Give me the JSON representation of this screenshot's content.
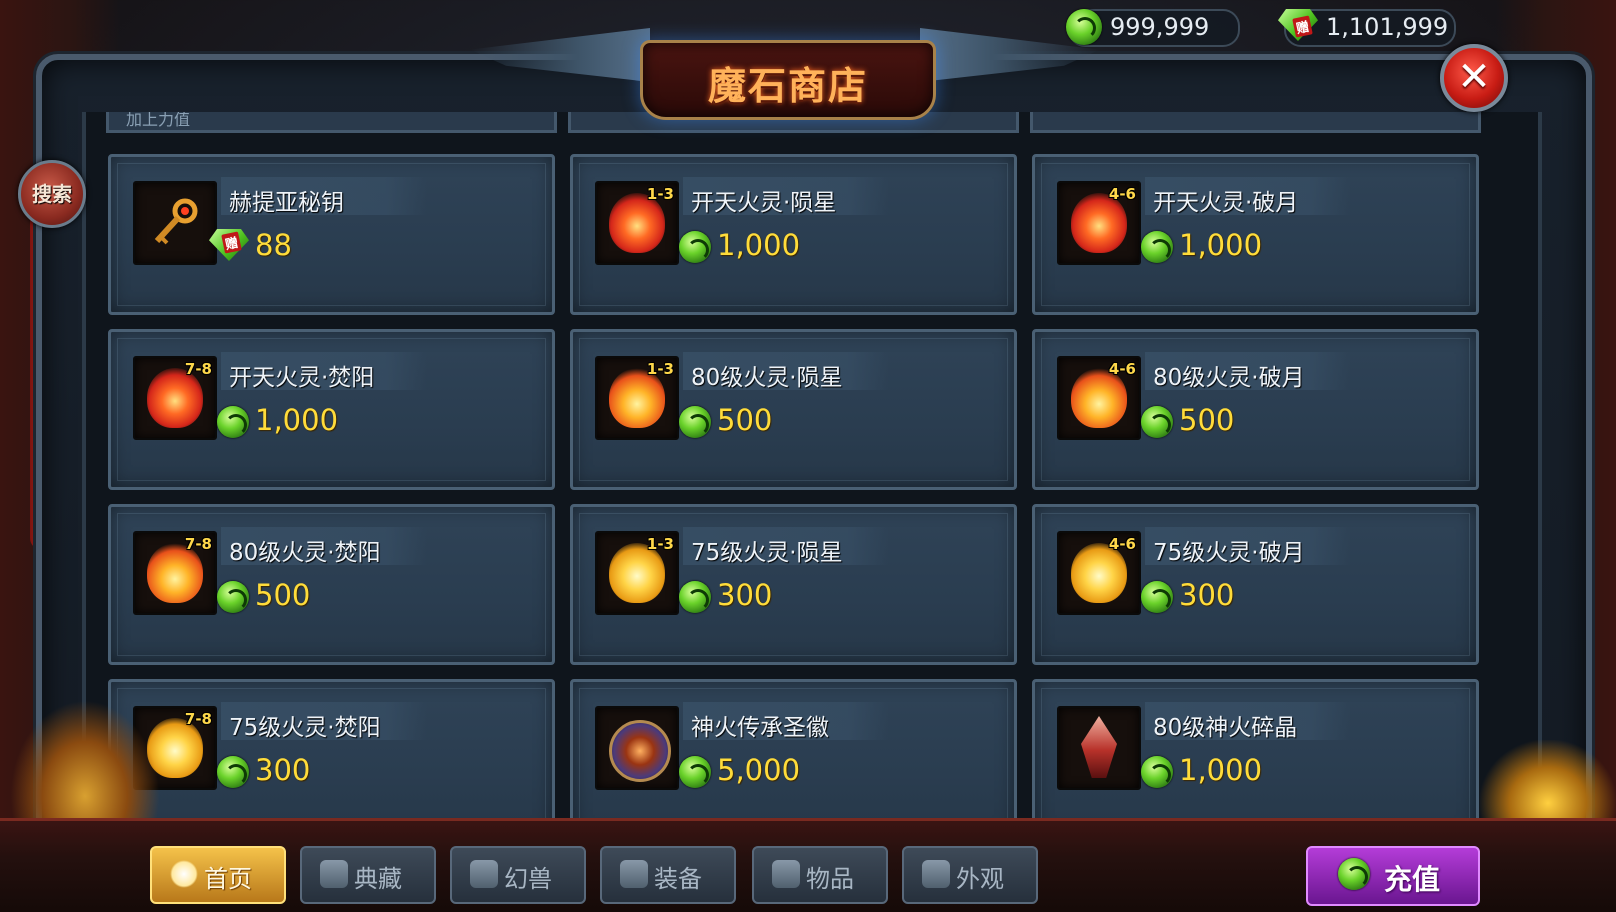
{
  "header": {
    "title": "魔石商店",
    "currency_main": "999,999",
    "currency_gift": "1,101,999",
    "gift_tag": "赠",
    "close_label": "✕"
  },
  "search_label": "搜索",
  "partial_row_label": "加上力值",
  "items": [
    {
      "name": "赫提亚秘钥",
      "price": "88",
      "badge": "",
      "gift": true,
      "icon": "key-icon"
    },
    {
      "name": "开天火灵·陨星",
      "price": "1,000",
      "badge": "1-3",
      "gift": false,
      "icon": "red-flame-icon"
    },
    {
      "name": "开天火灵·破月",
      "price": "1,000",
      "badge": "4-6",
      "gift": false,
      "icon": "red-flame-icon"
    },
    {
      "name": "开天火灵·焚阳",
      "price": "1,000",
      "badge": "7-8",
      "gift": false,
      "icon": "red-flame-icon"
    },
    {
      "name": "80级火灵·陨星",
      "price": "500",
      "badge": "1-3",
      "gift": false,
      "icon": "flame-icon"
    },
    {
      "name": "80级火灵·破月",
      "price": "500",
      "badge": "4-6",
      "gift": false,
      "icon": "flame-icon"
    },
    {
      "name": "80级火灵·焚阳",
      "price": "500",
      "badge": "7-8",
      "gift": false,
      "icon": "flame-icon"
    },
    {
      "name": "75级火灵·陨星",
      "price": "300",
      "badge": "1-3",
      "gift": false,
      "icon": "gold-flame-icon"
    },
    {
      "name": "75级火灵·破月",
      "price": "300",
      "badge": "4-6",
      "gift": false,
      "icon": "gold-flame-icon"
    },
    {
      "name": "75级火灵·焚阳",
      "price": "300",
      "badge": "7-8",
      "gift": false,
      "icon": "gold-flame-icon"
    },
    {
      "name": "神火传承圣徽",
      "price": "5,000",
      "badge": "",
      "gift": false,
      "icon": "emblem-icon"
    },
    {
      "name": "80级神火碎晶",
      "price": "1,000",
      "badge": "",
      "gift": false,
      "icon": "crystal-icon"
    }
  ],
  "tabs": [
    {
      "label": "首页",
      "active": true,
      "icon": "home-icon"
    },
    {
      "label": "典藏",
      "active": false,
      "icon": "scroll-icon"
    },
    {
      "label": "幻兽",
      "active": false,
      "icon": "beast-icon"
    },
    {
      "label": "装备",
      "active": false,
      "icon": "axe-icon"
    },
    {
      "label": "物品",
      "active": false,
      "icon": "flower-icon"
    },
    {
      "label": "外观",
      "active": false,
      "icon": "armor-icon"
    }
  ],
  "recharge_label": "充值",
  "colors": {
    "price": "#ffdc3a",
    "accent_title": "#ffb25a",
    "active_tab": "#f4c24a",
    "recharge": "#b43cd8"
  }
}
